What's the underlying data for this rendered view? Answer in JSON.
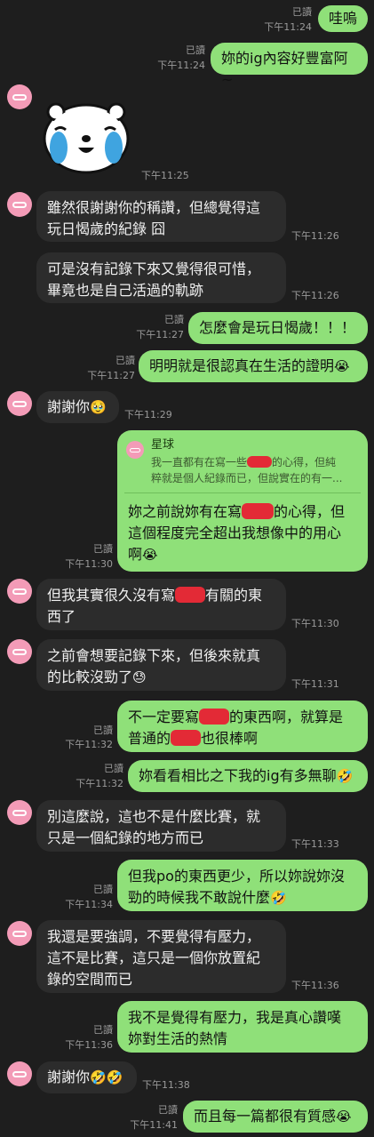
{
  "chat": {
    "read_label": "已讀",
    "messages": [
      {
        "id": "m1",
        "side": "sent",
        "text": "哇嗚",
        "time": "下午11:24",
        "read": true
      },
      {
        "id": "m2",
        "side": "sent",
        "text": "妳的ig內容好豐富阿~",
        "time": "下午11:24",
        "read": true
      },
      {
        "id": "m3",
        "side": "recv",
        "sticker": "crying-bear-sticker",
        "time": "下午11:25"
      },
      {
        "id": "m4",
        "side": "recv",
        "lines": [
          "雖然很謝謝你的稱讚，但總覺得這",
          "玩日愒歲的紀錄 囧"
        ],
        "time": "下午11:26"
      },
      {
        "id": "m5",
        "side": "recv",
        "lines": [
          "可是沒有記錄下來又覺得很可惜，",
          "畢竟也是自己活過的軌跡"
        ],
        "time": "下午11:26"
      },
      {
        "id": "m6",
        "side": "sent",
        "text": "怎麼會是玩日愒歲！！！",
        "time": "下午11:27",
        "read": true
      },
      {
        "id": "m7",
        "side": "sent",
        "text": "明明就是很認真在生活的證明",
        "emoji": "😭",
        "time": "下午11:27",
        "read": true
      },
      {
        "id": "m8",
        "side": "recv",
        "text": "謝謝你",
        "emoji": "🥹",
        "time": "下午11:29"
      },
      {
        "id": "m9",
        "side": "sent",
        "quote": {
          "name": "星球",
          "line1_a": "我一直都有在寫一些",
          "line1_b": "的心得，但純",
          "line2": "粹就是個人紀錄而已，但說實在的有一..."
        },
        "line1_a": "妳之前說妳有在寫",
        "line1_b": "的心得，但",
        "line2": "這個程度完全超出我想像中的用心",
        "line3": "啊",
        "emoji": "😭",
        "time": "下午11:30",
        "read": true
      },
      {
        "id": "m10",
        "side": "recv",
        "line1_a": "但我其實很久沒有寫",
        "line1_b": "有關的東",
        "line2": "西了",
        "time": "下午11:30"
      },
      {
        "id": "m11",
        "side": "recv",
        "lines": [
          "之前會想要記錄下來，但後來就真",
          "的比較沒勁了"
        ],
        "emoji": "😓",
        "time": "下午11:31"
      },
      {
        "id": "m12",
        "side": "sent",
        "line1_a": "不一定要寫",
        "line1_b": "的東西啊，就算是",
        "line2_a": "普通的",
        "line2_b": "也很棒啊",
        "time": "下午11:32",
        "read": true
      },
      {
        "id": "m13",
        "side": "sent",
        "text": "妳看看相比之下我的ig有多無聊",
        "emoji": "🤣",
        "time": "下午11:32",
        "read": true
      },
      {
        "id": "m14",
        "side": "recv",
        "lines": [
          "別這麼說，這也不是什麼比賽，就",
          "只是一個紀錄的地方而已"
        ],
        "time": "下午11:33"
      },
      {
        "id": "m15",
        "side": "sent",
        "lines": [
          "但我po的東西更少，所以妳說妳沒",
          "勁的時候我不敢說什麼"
        ],
        "emoji": "🤣",
        "time": "下午11:34",
        "read": true
      },
      {
        "id": "m16",
        "side": "recv",
        "lines": [
          "我還是要強調，不要覺得有壓力，",
          "這不是比賽，這只是一個你放置紀",
          "錄的空間而已"
        ],
        "time": "下午11:36"
      },
      {
        "id": "m17",
        "side": "sent",
        "lines": [
          "我不是覺得有壓力，我是真心讚嘆",
          "妳對生活的熱情"
        ],
        "time": "下午11:36",
        "read": true
      },
      {
        "id": "m18",
        "side": "recv",
        "text": "謝謝你",
        "emoji": "🤣🤣",
        "time": "下午11:38"
      },
      {
        "id": "m19",
        "side": "sent",
        "text": "而且每一篇都很有質感",
        "emoji": "😭",
        "time": "下午11:41",
        "read": true
      }
    ]
  },
  "colors": {
    "background": "#1e1e1e",
    "sent_bubble": "#8fe079",
    "received_bubble": "#2c2c2c",
    "redaction": "#e32a36",
    "avatar": "#f39bb7"
  }
}
